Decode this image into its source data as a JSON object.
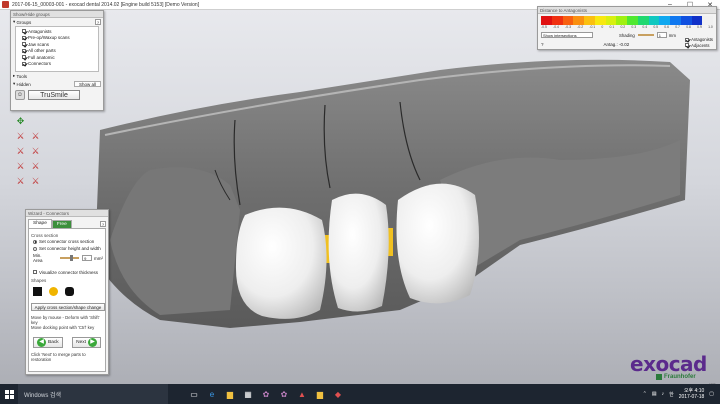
{
  "window": {
    "title": "2017-06-15_00003-001 - exocad dental 2014.02 [Engine build 5153] [Demo Version]",
    "buttons": {
      "minimize": "–",
      "maximize": "☐",
      "close": "✕"
    }
  },
  "show_hide_panel": {
    "header": "Show/Hide groups",
    "groups_label": "Groups",
    "help": "?",
    "items": [
      {
        "label": "Antagonists",
        "checked": true
      },
      {
        "label": "Pre-op/Waxup scans",
        "checked": true
      },
      {
        "label": "Jaw scans",
        "checked": true
      },
      {
        "label": "All other parts",
        "checked": true
      },
      {
        "label": "Full anatomic",
        "checked": true
      },
      {
        "label": "Connectors",
        "checked": true
      }
    ],
    "tools_label": "Tools",
    "hidden_label": "Hidden",
    "show_all_button": "Show all",
    "trusmile_button": "TruSmile"
  },
  "toolbar": {
    "icons": [
      "rotate-icon",
      "view-front-icon",
      "view-left-icon",
      "view-right-icon",
      "view-top-icon",
      "view-bottom-icon",
      "view-back-icon",
      "view-side-icon",
      "axis-icon",
      "axis2-icon"
    ]
  },
  "wizard": {
    "header": "Wizard - Connectors",
    "tabs": {
      "shape": "Shape",
      "free": "Free"
    },
    "help": "?",
    "cross_section_label": "Cross section",
    "options": [
      {
        "label": "Set connector cross section",
        "selected": true
      },
      {
        "label": "Set connector height and width",
        "selected": false
      }
    ],
    "min_area_label": "Min. Area",
    "min_area_value": "9",
    "min_area_unit": "mm²",
    "visualize_label": "Visualize connector thickness",
    "shapes_label": "Shapes",
    "apply_button": "Apply cross section/shape change",
    "hint1": "Move by mouse - Deform with 'Shift' key",
    "hint2": "Move docking point with 'Ctrl' key",
    "back_button": "Back",
    "next_button": "Next",
    "footer_hint": "Click 'Next' to merge parts to restoration"
  },
  "distance_panel": {
    "header": "Distance to Antagonists",
    "scale_labels": [
      "-0.5",
      "-0.4",
      "-0.3",
      "-0.2",
      "-0.1",
      "0",
      "0.1",
      "0.2",
      "0.3",
      "0.4",
      "0.5",
      "0.6",
      "0.7",
      "0.8",
      "0.9",
      "1.0"
    ],
    "scale_colors": [
      "#e01010",
      "#f03010",
      "#f86010",
      "#fa9010",
      "#fbc010",
      "#f8e810",
      "#d8f010",
      "#a0f010",
      "#50e830",
      "#20d870",
      "#10c8c0",
      "#10a8f0",
      "#1078f0",
      "#1050e0",
      "#1030c8",
      "#f0f0f0"
    ],
    "mode_select": "Show intersections",
    "shading_label": "Shading",
    "shading_value": "1",
    "shading_unit": "mm",
    "checks": [
      {
        "label": "Antagonists",
        "checked": true
      },
      {
        "label": "Adjacents",
        "checked": true
      }
    ],
    "help": "?",
    "antag_value": "Antag.: -0.02"
  },
  "logo": {
    "word": "exocad",
    "sub": "Fraunhofer",
    "sub2": "IGD"
  },
  "taskbar": {
    "search_placeholder": "Windows 검색",
    "tray_lang": "한",
    "time": "4:10",
    "date": "2017-07-18",
    "ampm": "오후"
  }
}
